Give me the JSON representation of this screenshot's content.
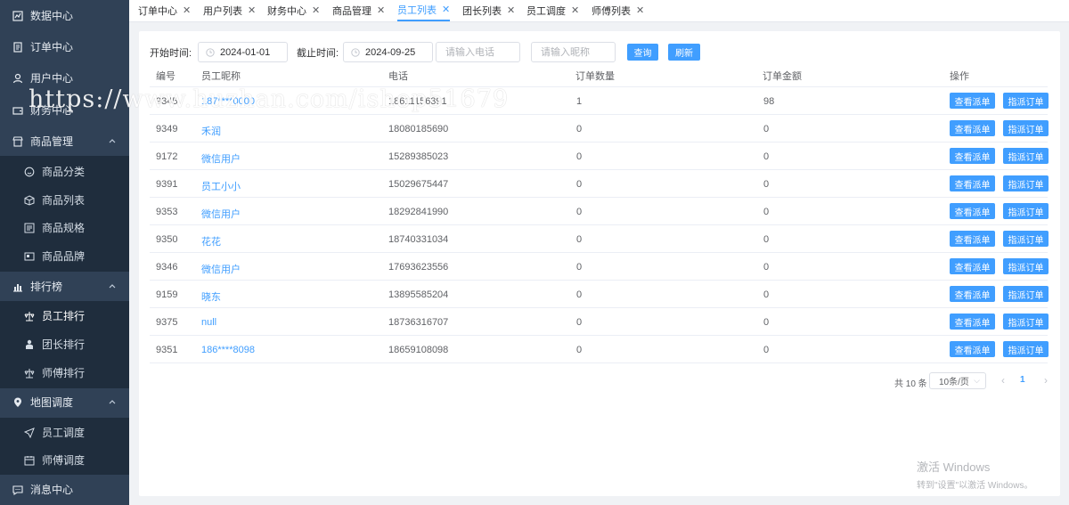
{
  "sidebar": {
    "items": [
      {
        "label": "数据中心",
        "icon": "dashboard-icon"
      },
      {
        "label": "订单中心",
        "icon": "document-icon"
      },
      {
        "label": "用户中心",
        "icon": "user-icon"
      },
      {
        "label": "财务中心",
        "icon": "wallet-icon"
      },
      {
        "label": "商品管理",
        "icon": "store-icon"
      },
      {
        "label": "商品分类",
        "icon": "smile-icon"
      },
      {
        "label": "商品列表",
        "icon": "box-icon"
      },
      {
        "label": "商品规格",
        "icon": "spec-icon"
      },
      {
        "label": "商品品牌",
        "icon": "brand-icon"
      },
      {
        "label": "排行榜",
        "icon": "bar-chart-icon"
      },
      {
        "label": "员工排行",
        "icon": "scale-icon"
      },
      {
        "label": "团长排行",
        "icon": "person-icon"
      },
      {
        "label": "师傅排行",
        "icon": "scale-icon"
      },
      {
        "label": "地图调度",
        "icon": "location-icon"
      },
      {
        "label": "员工调度",
        "icon": "send-icon"
      },
      {
        "label": "师傅调度",
        "icon": "calendar-icon"
      },
      {
        "label": "消息中心",
        "icon": "message-icon"
      }
    ]
  },
  "tabs": [
    {
      "label": "订单中心"
    },
    {
      "label": "用户列表"
    },
    {
      "label": "财务中心"
    },
    {
      "label": "商品管理"
    },
    {
      "label": "员工列表"
    },
    {
      "label": "团长列表"
    },
    {
      "label": "员工调度"
    },
    {
      "label": "师傅列表"
    }
  ],
  "filters": {
    "start_label": "开始时间:",
    "start_value": "2024-01-01",
    "end_label": "截止时间:",
    "end_value": "2024-09-25",
    "phone_placeholder": "请输入电话",
    "nickname_placeholder": "请输入昵称",
    "query_label": "查询",
    "refresh_label": "刷新"
  },
  "table": {
    "headers": [
      "编号",
      "员工昵称",
      "电话",
      "订单数量",
      "订单金额",
      "操作"
    ],
    "rows": [
      {
        "id": "9345",
        "nick": "187****0000",
        "phone": "18611156391",
        "count": "1",
        "amount": "98"
      },
      {
        "id": "9349",
        "nick": "禾润",
        "phone": "18080185690",
        "count": "0",
        "amount": "0"
      },
      {
        "id": "9172",
        "nick": "微信用户",
        "phone": "15289385023",
        "count": "0",
        "amount": "0"
      },
      {
        "id": "9391",
        "nick": "员工小小",
        "phone": "15029675447",
        "count": "0",
        "amount": "0"
      },
      {
        "id": "9353",
        "nick": "微信用户",
        "phone": "18292841990",
        "count": "0",
        "amount": "0"
      },
      {
        "id": "9350",
        "nick": "花花",
        "phone": "18740331034",
        "count": "0",
        "amount": "0"
      },
      {
        "id": "9346",
        "nick": "微信用户",
        "phone": "17693623556",
        "count": "0",
        "amount": "0"
      },
      {
        "id": "9159",
        "nick": "晓东",
        "phone": "13895585204",
        "count": "0",
        "amount": "0"
      },
      {
        "id": "9375",
        "nick": "null",
        "phone": "18736316707",
        "count": "0",
        "amount": "0"
      },
      {
        "id": "9351",
        "nick": "186****8098",
        "phone": "18659108098",
        "count": "0",
        "amount": "0"
      }
    ],
    "action_view": "查看派单",
    "action_assign": "指派订单"
  },
  "pagination": {
    "total": "共 10 条",
    "page_size": "10条/页",
    "current_page": "1"
  },
  "watermark": {
    "url": "https://www.huzhan.com/ishop51679"
  },
  "windows_activation": {
    "line1": "激活 Windows",
    "line2": "转到\"设置\"以激活 Windows。"
  },
  "colors": {
    "sidebar_bg": "#304156",
    "submenu_bg": "#1f2d3d",
    "primary": "#409eff"
  }
}
